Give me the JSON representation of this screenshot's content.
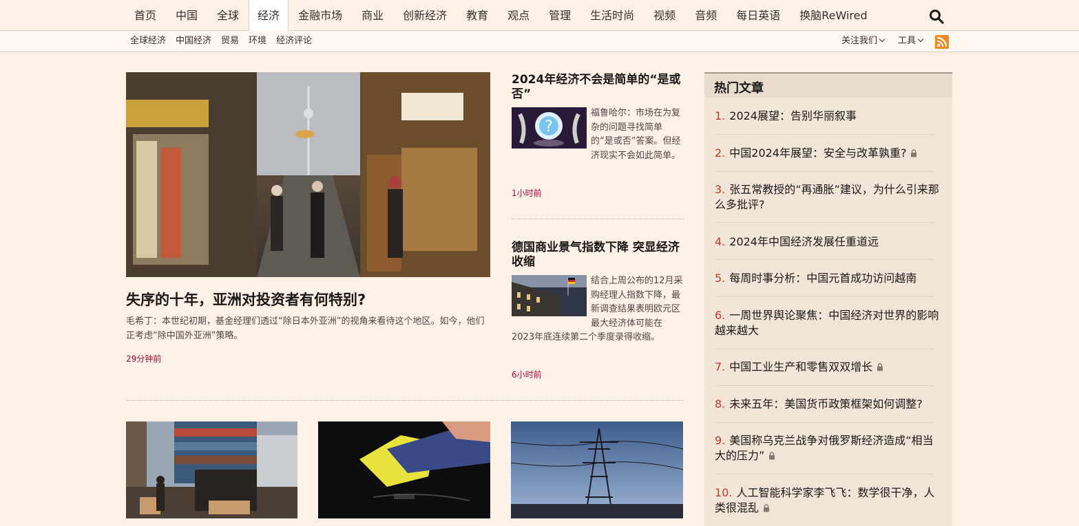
{
  "nav": {
    "items": [
      "首页",
      "中国",
      "全球",
      "经济",
      "金融市场",
      "商业",
      "创新经济",
      "教育",
      "观点",
      "管理",
      "生活时尚",
      "视频",
      "音频",
      "每日英语",
      "换脑ReWired"
    ],
    "active_index": 3
  },
  "subnav": {
    "items": [
      "全球经济",
      "中国经济",
      "贸易",
      "环境",
      "经济评论"
    ],
    "follow_label": "关注我们",
    "tools_label": "工具"
  },
  "lead": {
    "title": "失序的十年，亚洲对投资者有何特别?",
    "summary": "毛希丁：本世纪初期，基金经理们透过“除日本外亚洲”的视角来看待这个地区。如今，他们正考虑“除中国外亚洲”策略。",
    "time": "29分钟前"
  },
  "side_stories": [
    {
      "title": "2024年经济不会是简单的“是或否”",
      "summary": "福鲁哈尔：市场在为复杂的问题寻找简单的“是或否”答案。但经济现实不会如此简单。",
      "time": "1小时前"
    },
    {
      "title": "德国商业景气指数下降 突显经济收缩",
      "summary": "结合上周公布的12月采购经理人指数下降，最新调查结果表明欧元区最大经济体可能在2023年底连续第二个季度录得收缩。",
      "time": "6小时前"
    }
  ],
  "hot": {
    "heading": "热门文章",
    "items": [
      {
        "num": "1.",
        "title": "2024展望：告别华丽叙事",
        "locked": false
      },
      {
        "num": "2.",
        "title": "中国2024年展望：安全与改革孰重?",
        "locked": true
      },
      {
        "num": "3.",
        "title": "张五常教授的“再通胀”建议，为什么引来那么多批评?",
        "locked": false
      },
      {
        "num": "4.",
        "title": "2024年中国经济发展任重道远",
        "locked": false
      },
      {
        "num": "5.",
        "title": "每周时事分析：中国元首成功访问越南",
        "locked": false
      },
      {
        "num": "6.",
        "title": "一周世界舆论聚焦：中国经济对世界的影响越来越大",
        "locked": false
      },
      {
        "num": "7.",
        "title": "中国工业生产和零售双双增长",
        "locked": true
      },
      {
        "num": "8.",
        "title": "未来五年：美国货币政策框架如何调整?",
        "locked": false
      },
      {
        "num": "9.",
        "title": "美国称乌克兰战争对俄罗斯经济造成“相当大的压力”",
        "locked": true
      },
      {
        "num": "10.",
        "title": "人工智能科学家李飞飞：数学很干净，人类很混乱",
        "locked": true
      }
    ]
  },
  "colors": {
    "background": "#fff1e5",
    "accent": "#990f3d",
    "rank_number": "#c0392b",
    "panel": "#f2e5d8"
  }
}
